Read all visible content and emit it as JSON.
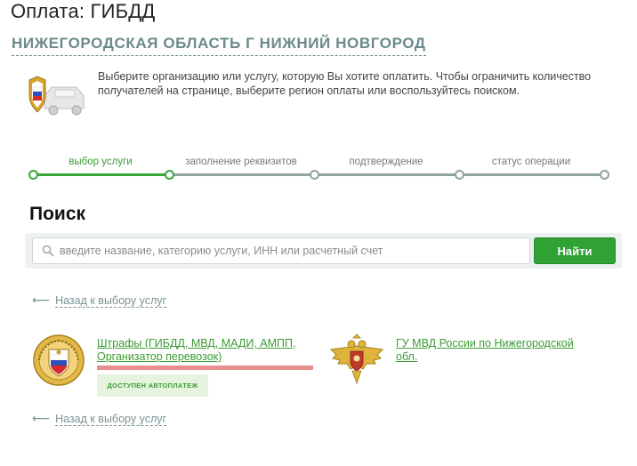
{
  "page": {
    "title": "Оплата: ГИБДД",
    "region": "НИЖЕГОРОДСКАЯ ОБЛАСТЬ Г НИЖНИЙ НОВГОРОД"
  },
  "intro": {
    "icon": "gibdd-car-icon",
    "text": "Выберите организацию или услугу, которую Вы хотите оплатить. Чтобы ограничить количество получателей на странице, выберите регион оплаты или воспользуйтесь поиском."
  },
  "steps": [
    {
      "label": "выбор услуги",
      "active": true
    },
    {
      "label": "заполнение реквизитов",
      "active": false
    },
    {
      "label": "подтверждение",
      "active": false
    },
    {
      "label": "статус операции",
      "active": false
    }
  ],
  "search": {
    "heading": "Поиск",
    "placeholder": "введите название, категорию услуги, ИНН или расчетный счет",
    "value": "",
    "button_label": "Найти",
    "icon": "search-icon"
  },
  "back_link": {
    "arrow": "⟵",
    "label": "Назад к выбору услуг"
  },
  "results": [
    {
      "icon": "gibdd-emblem-icon",
      "label": "Штрафы (ГИБДД, МВД, МАДИ, АМПП, Организатор перевозок)",
      "badge": "ДОСТУПЕН АВТОПЛАТЕЖ"
    },
    {
      "icon": "mvd-eagle-icon",
      "label": "ГУ МВД России по Нижегородской обл."
    }
  ],
  "colors": {
    "accent_green": "#2fa233",
    "link_green": "#3a9a32",
    "muted_teal": "#6b8a8a",
    "highlight_red": "#e88f8f"
  }
}
